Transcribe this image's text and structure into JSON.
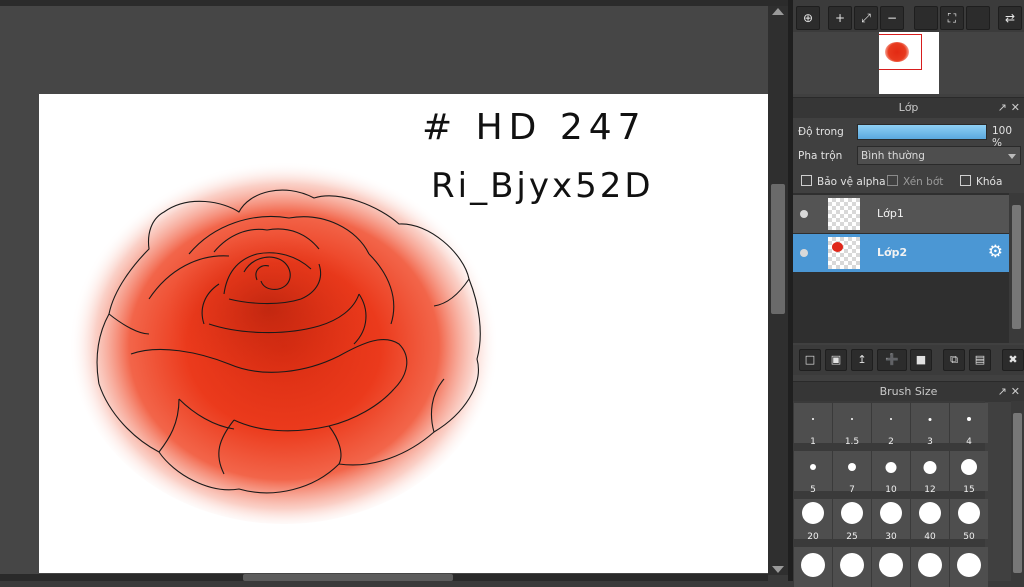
{
  "canvas": {
    "note_line1": "# HD 247",
    "note_line2": "Ri_Bjyx52D"
  },
  "navigator": {
    "tools": [
      {
        "icon": "zoom-fit-icon",
        "glyph": "⊕"
      },
      {
        "icon": "zoom-in-icon",
        "glyph": "+"
      },
      {
        "icon": "fit-window-icon",
        "glyph": "⤢"
      },
      {
        "icon": "zoom-out-icon",
        "glyph": "−"
      },
      {
        "icon": "blank-tool-icon",
        "glyph": ""
      },
      {
        "icon": "fullscreen-icon",
        "glyph": "⛶"
      },
      {
        "icon": "blank-tool-icon",
        "glyph": ""
      },
      {
        "icon": "flip-icon",
        "glyph": "⇄"
      }
    ]
  },
  "layers_panel": {
    "title": "Lớp",
    "opacity_label": "Độ trong",
    "opacity_value": "100 %",
    "opacity_level": 1.0,
    "blend_label": "Pha trộn",
    "blend_value": "Bình thường",
    "checkboxes": [
      "Bảo vệ alpha",
      "Xén bớt",
      "Khóa"
    ],
    "layers": [
      {
        "name": "Lớp1",
        "selected": false
      },
      {
        "name": "Lớp2",
        "selected": true
      }
    ],
    "toolbar_icons": [
      "new-layer-icon",
      "new-layer-copy-icon",
      "import-layer-icon",
      "add-layer-menu-icon",
      "folder-icon",
      "duplicate-layer-icon",
      "merge-layer-icon",
      "delete-icon"
    ]
  },
  "brush_panel": {
    "title": "Brush Size",
    "sizes": [
      "1",
      "1.5",
      "2",
      "3",
      "4",
      "5",
      "7",
      "10",
      "12",
      "15",
      "20",
      "25",
      "30",
      "40",
      "50"
    ]
  },
  "colors": {
    "selected_layer": "#4b97d4",
    "rose": "#e83a1e",
    "canvas_bg": "#ffffff"
  }
}
